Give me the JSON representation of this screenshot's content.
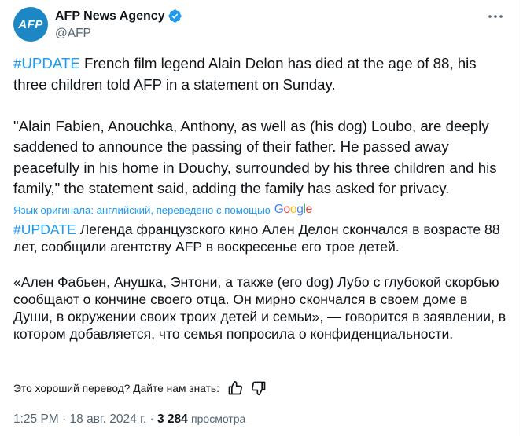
{
  "author": {
    "avatar_text": "AFP",
    "name": "AFP News Agency",
    "handle": "@AFP",
    "verified": true,
    "verified_color": "#1d9bf0",
    "avatar_color": "#1d87c6"
  },
  "tweet": {
    "hashtag": "#UPDATE",
    "text_line1": " French film legend Alain Delon has died at the age of 88, his three children told AFP in a statement on Sunday.",
    "text_quote": "\"Alain Fabien, Anouchka, Anthony, as well as (his dog) Loubo, are deeply saddened to announce the passing of their father. He passed away peacefully in his home in Douchy, surrounded by his three children and his family,\" the statement said, adding the family has asked for privacy."
  },
  "translation": {
    "notice": "Язык оригинала: английский, переведено с помощью",
    "provider": [
      "G",
      "o",
      "o",
      "g",
      "l",
      "e"
    ],
    "hashtag": "#UPDATE",
    "text_line1": " Легенда французского кино Ален Делон скончался в возрасте 88 лет, сообщили агентству AFP в воскресенье его трое детей.",
    "text_quote": "«Ален Фабьен, Анушка, Энтони, а также (его dog) Лубо с глубокой скорбью сообщают о кончине своего отца. Он мирно скончался в своем доме в Души, в окружении своих троих детей и семьи», — говорится в заявлении, в котором добавляется, что семья попросила о конфиденциальности."
  },
  "feedback": {
    "question": "Это хороший перевод? Дайте нам знать:",
    "like_icon": "thumbs-up-icon",
    "dislike_icon": "thumbs-down-icon"
  },
  "meta": {
    "time": "1:25 PM",
    "separator": " · ",
    "date": "18 авг. 2024 г.",
    "views_count": "3 284",
    "views_label": "просмотра"
  },
  "icons": {
    "more": "more-options-icon",
    "verified": "verified-badge-icon"
  }
}
